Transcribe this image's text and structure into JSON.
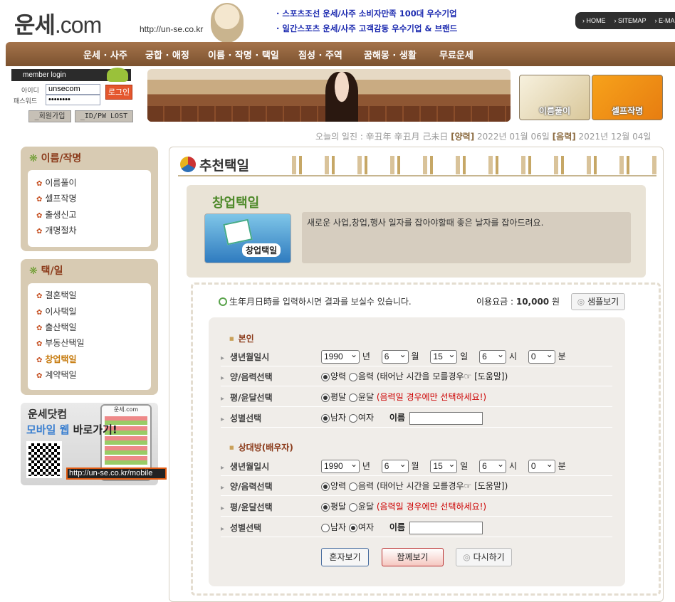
{
  "header": {
    "logo": "운세",
    "logo_suffix": ".com",
    "url": "http://un-se.co.kr",
    "headlines": [
      "· 스포츠조선 운세/사주 소비자만족 100대 우수기업",
      "· 일간스포츠 운세/사주 고객감동 우수기업 & 브랜드"
    ],
    "top_links": [
      "› HOME",
      "› SITEMAP",
      "› E-MAIL"
    ]
  },
  "nav": {
    "items": [
      "운세 · 사주",
      "궁합 · 애정",
      "이름 · 작명 · 택일",
      "점성 · 주역",
      "꿈해몽 · 생활",
      "무료운세"
    ]
  },
  "login": {
    "title": "member login",
    "id_label": "아이디",
    "pw_label": "패스워드",
    "id_value": "unsecom",
    "pw_value": "••••••••",
    "login_button": "로그인",
    "join_button": "_회원가입",
    "lost_button": "_ID/PW LOST"
  },
  "promos": [
    "이름풀이",
    "셀프작명"
  ],
  "dateline": {
    "prefix": "오늘의 일진 : 辛丑年 辛丑月 己未日 ",
    "solar_label": "[양력]",
    "solar_date": " 2022년 01월 06일 ",
    "lunar_label": "[음력]",
    "lunar_date": " 2021년 12월 04일"
  },
  "sidebar": {
    "group1": {
      "title": "이름/작명",
      "items": [
        "이름풀이",
        "셀프작명",
        "출생신고",
        "개명절차"
      ]
    },
    "group2": {
      "title": "택/일",
      "items": [
        "결혼택일",
        "이사택일",
        "출산택일",
        "부동산택일",
        "창업택일",
        "계약택일"
      ]
    },
    "mobile": {
      "line1": "운세닷컴",
      "line2a": "모바일 웹",
      "line2b": " 바로가기!",
      "url": "http://un-se.co.kr/mobile",
      "shot_title": "운세.com"
    }
  },
  "main": {
    "page_title": "추천택일",
    "sub_title": "창업택일",
    "sub_icon_label": "창업택일",
    "description": "새로운 사업,창업,행사 일자를 잡아야할때 좋은 날자를 잡아드려요.",
    "intro": "生年月日時를 입력하시면 결과를 보실수 있습니다.",
    "fee_label": "이용요금 : ",
    "fee_value": "10,000",
    "fee_unit": " 원",
    "sample_button": "샘플보기"
  },
  "form": {
    "labels": {
      "birth": "생년월일시",
      "lunar": "양/음력선택",
      "leap": "평/윤달선택",
      "gender": "성별선택"
    },
    "units": {
      "year": "년",
      "month": "월",
      "day": "일",
      "hour": "시",
      "minute": "분"
    },
    "options": {
      "solar": "양력",
      "lunar": "음력",
      "lunar_note": " (태어난 시간을 모를경우☞ [도움말])",
      "normal": "평달",
      "leap": "윤달",
      "leap_note": " (음력일 경우에만 선택하세요!)",
      "male": "남자",
      "female": "여자",
      "name_label": "이름"
    },
    "self": {
      "title": "본인",
      "year": "1990",
      "month": "6",
      "day": "15",
      "hour": "6",
      "minute": "0",
      "gender": "male"
    },
    "partner": {
      "title": "상대방(배우자)",
      "year": "1990",
      "month": "6",
      "day": "15",
      "hour": "6",
      "minute": "0",
      "gender": "female"
    },
    "buttons": {
      "alone": "혼자보기",
      "together": "함께보기",
      "reset": "다시하기"
    }
  }
}
